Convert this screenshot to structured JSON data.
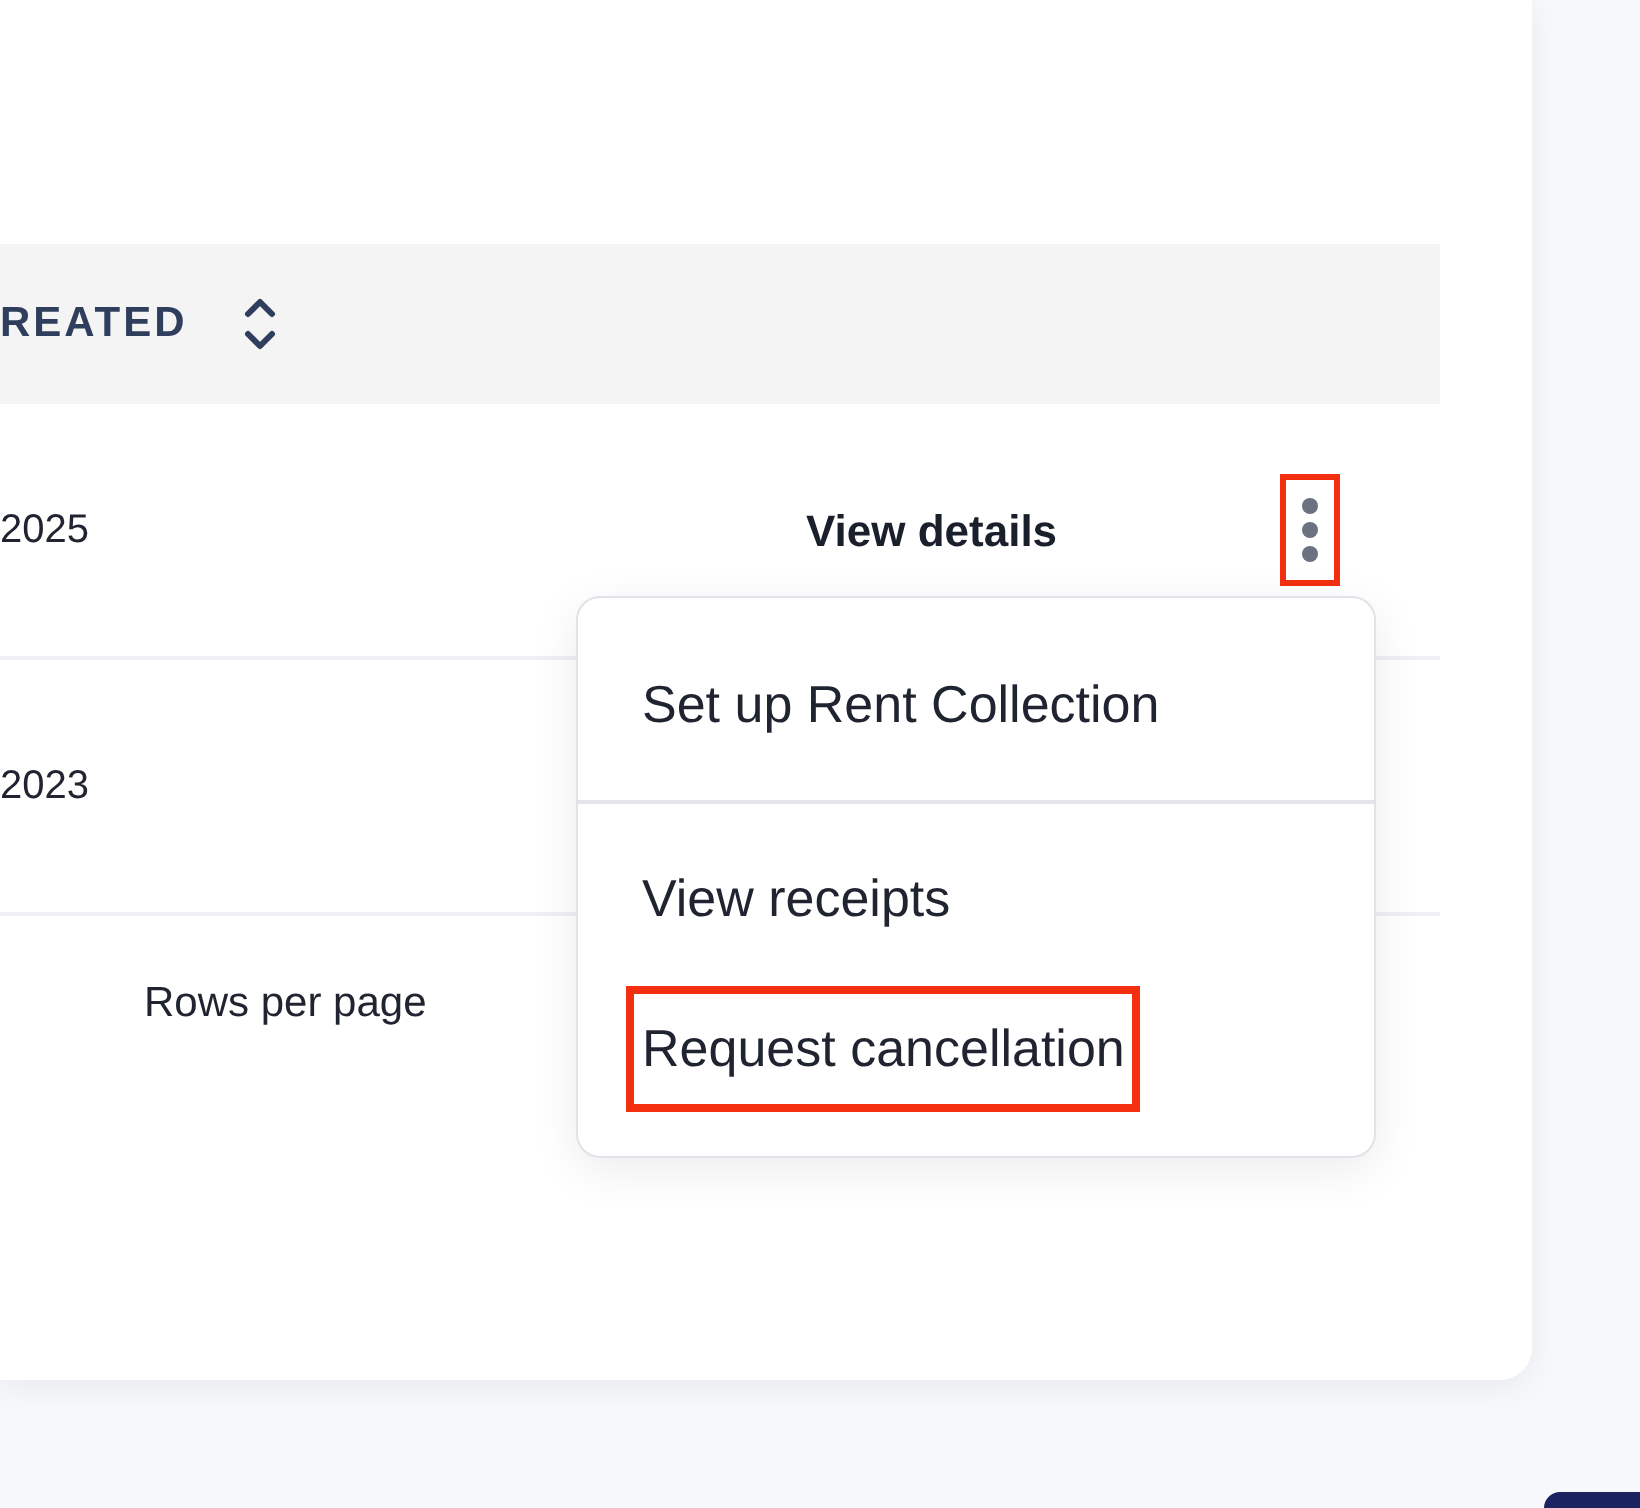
{
  "table": {
    "columns": [
      {
        "label": "REATED",
        "sortable": true
      }
    ],
    "rows": [
      {
        "date": "2025",
        "action": "View details",
        "menu_highlighted": true
      },
      {
        "date": "2023"
      }
    ]
  },
  "row_menu": {
    "items": [
      {
        "label": "Set up Rent Collection",
        "highlighted": false,
        "divider_after": true
      },
      {
        "label": "View receipts",
        "highlighted": false,
        "divider_after": false
      },
      {
        "label": "Request cancellation",
        "highlighted": true,
        "divider_after": false
      }
    ]
  },
  "pagination": {
    "rows_per_page_label": "Rows per page"
  }
}
